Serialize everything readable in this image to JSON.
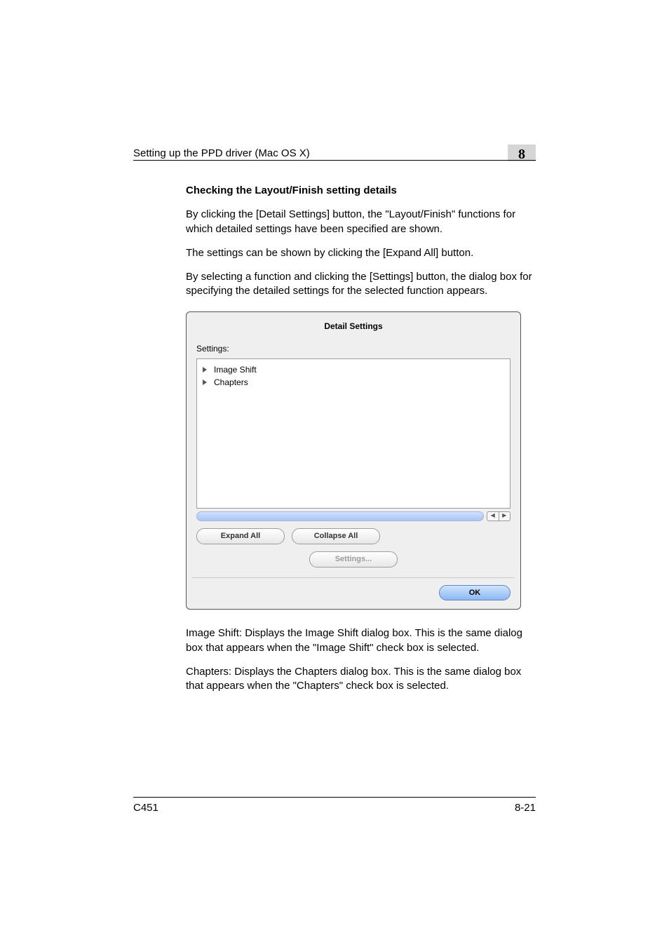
{
  "header": {
    "running": "Setting up the PPD driver (Mac OS X)",
    "chapter_number": "8"
  },
  "body": {
    "heading": "Checking the Layout/Finish setting details",
    "para1": "By clicking the [Detail Settings] button, the \"Layout/Finish\" functions for which detailed settings have been specified are shown.",
    "para2": "The settings can be shown by clicking the [Expand All] button.",
    "para3": "By selecting a function and clicking the [Settings] button, the dialog box for specifying the detailed settings for the selected function appears.",
    "para_img_shift": "Image Shift: Displays the Image Shift dialog box. This is the same dialog box that appears when the \"Image Shift\" check box is selected.",
    "para_chapters": "Chapters: Displays the Chapters dialog box. This is the same dialog box that appears when the \"Chapters\" check box is selected."
  },
  "dialog": {
    "title": "Detail Settings",
    "settings_label": "Settings:",
    "items": [
      "Image Shift",
      "Chapters"
    ],
    "buttons": {
      "expand_all": "Expand All",
      "collapse_all": "Collapse All",
      "settings": "Settings...",
      "ok": "OK"
    },
    "scroll_left_glyph": "◀",
    "scroll_right_glyph": "▶"
  },
  "footer": {
    "model": "C451",
    "page_number": "8-21"
  }
}
